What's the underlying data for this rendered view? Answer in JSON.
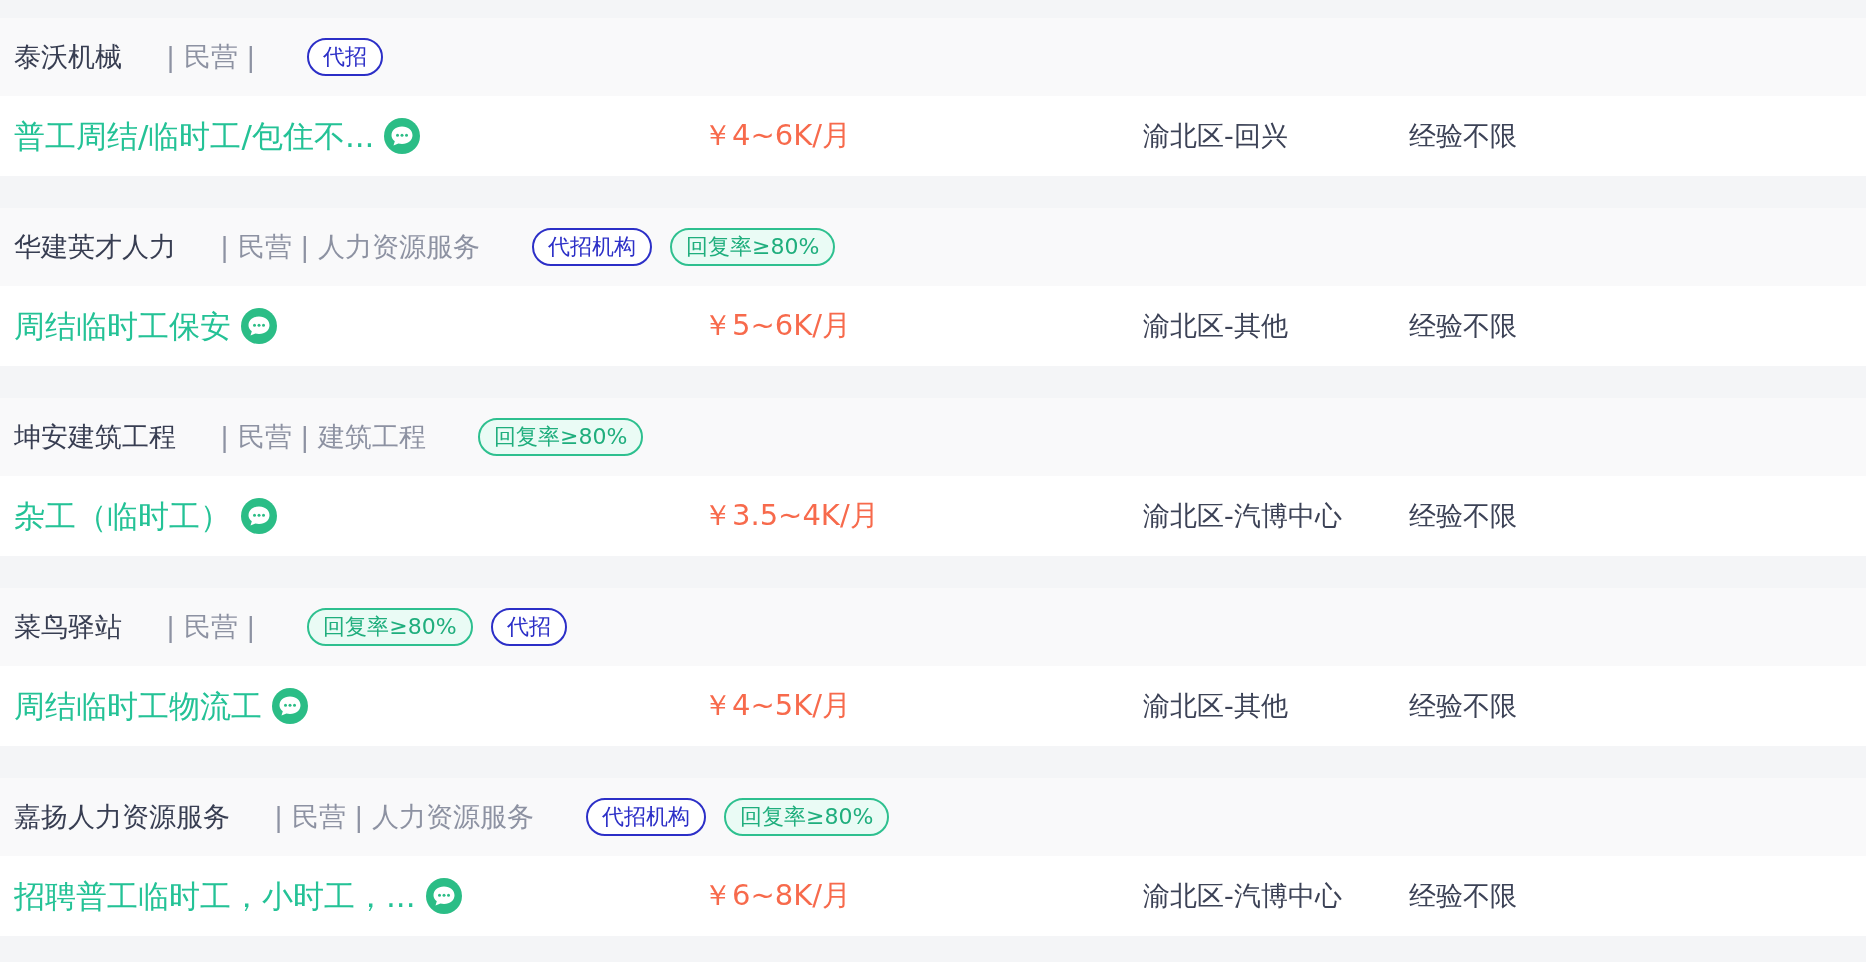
{
  "jobs": [
    {
      "company": {
        "name": "泰沃机械",
        "meta": "| 民营 |",
        "tags": [
          {
            "kind": "agency",
            "label": "代招"
          }
        ]
      },
      "title": "普工周结/临时工/包住不...",
      "salary": "￥4~6K/月",
      "location": "渝北区-回兴",
      "experience": "经验不限"
    },
    {
      "company": {
        "name": "华建英才人力",
        "meta": "| 民营 | 人力资源服务",
        "tags": [
          {
            "kind": "agency",
            "label": "代招机构"
          },
          {
            "kind": "reply-rate",
            "label": "回复率≥80%"
          }
        ]
      },
      "title": "周结临时工保安",
      "salary": "￥5~6K/月",
      "location": "渝北区-其他",
      "experience": "经验不限"
    },
    {
      "company": {
        "name": "坤安建筑工程",
        "meta": "| 民营 | 建筑工程",
        "tags": [
          {
            "kind": "reply-rate",
            "label": "回复率≥80%"
          }
        ]
      },
      "title": "杂工（临时工）",
      "salary": "￥3.5~4K/月",
      "location": "渝北区-汽博中心",
      "experience": "经验不限"
    },
    {
      "company": {
        "name": "菜鸟驿站",
        "meta": "| 民营 |",
        "tags": [
          {
            "kind": "reply-rate",
            "label": "回复率≥80%"
          },
          {
            "kind": "agency",
            "label": "代招"
          }
        ]
      },
      "title": "周结临时工物流工",
      "salary": "￥4~5K/月",
      "location": "渝北区-其他",
      "experience": "经验不限"
    },
    {
      "company": {
        "name": "嘉扬人力资源服务",
        "meta": "| 民营 | 人力资源服务",
        "tags": [
          {
            "kind": "agency",
            "label": "代招机构"
          },
          {
            "kind": "reply-rate",
            "label": "回复率≥80%"
          }
        ]
      },
      "title": "招聘普工临时工，小时工，...",
      "salary": "￥6~8K/月",
      "location": "渝北区-汽博中心",
      "experience": "经验不限"
    }
  ]
}
